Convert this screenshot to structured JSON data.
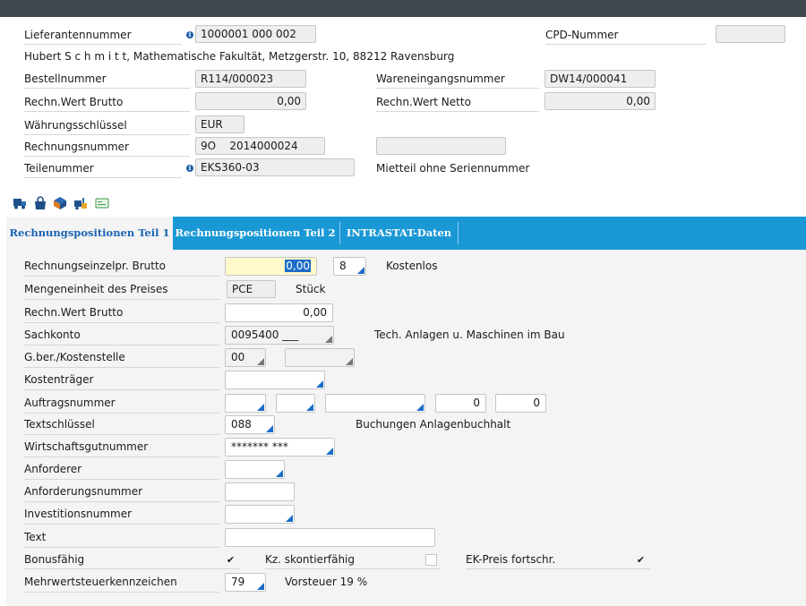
{
  "header": {
    "lieferant_label": "Lieferantennummer",
    "lieferant_value": "1000001 000 002",
    "cpd_label": "CPD-Nummer",
    "cpd_value": "",
    "address": "Hubert S c h m i t t, Mathematische Fakultät, Metzgerstr. 10, 88212 Ravensburg",
    "bestell_label": "Bestellnummer",
    "bestell_value": "R114/000023",
    "wareneingang_label": "Wareneingangsnummer",
    "wareneingang_value": "DW14/000041",
    "brutto_label": "Rechn.Wert Brutto",
    "brutto_value": "0,00",
    "netto_label": "Rechn.Wert Netto",
    "netto_value": "0,00",
    "waehrung_label": "Währungsschlüssel",
    "waehrung_value": "EUR",
    "rechnung_label": "Rechnungsnummer",
    "rechnung_value": "9O    2014000024",
    "rechnung_extra": "",
    "teil_label": "Teilenummer",
    "teil_value": "EKS360-03",
    "teil_desc": "Mietteil ohne Seriennummer"
  },
  "toolbar": {
    "icons": [
      "truck-icon",
      "bag-icon",
      "boxes-icon",
      "forklift-icon",
      "card-icon"
    ]
  },
  "tabs": [
    {
      "label": "Rechnungspositionen Teil 1"
    },
    {
      "label": "Rechnungspositionen Teil 2"
    },
    {
      "label": "INTRASTAT-Daten"
    }
  ],
  "form": {
    "einzelpr_label": "Rechnungseinzelpr. Brutto",
    "einzelpr_value": "0,00",
    "einzelpr_code": "8",
    "einzelpr_desc": "Kostenlos",
    "mengeneinheit_label": "Mengeneinheit des Preises",
    "mengeneinheit_value": "PCE",
    "mengeneinheit_desc": "Stück",
    "brutto_label": "Rechn.Wert Brutto",
    "brutto_value": "0,00",
    "sachkonto_label": "Sachkonto",
    "sachkonto_value": "0095400 ___",
    "sachkonto_desc": "Tech. Anlagen u. Maschinen im Bau",
    "gber_label": "G.ber./Kostenstelle",
    "gber_value": "00",
    "gber_value2": "",
    "kostentraeger_label": "Kostenträger",
    "kostentraeger_value": "",
    "auftrag_label": "Auftragsnummer",
    "auftrag_num1": "0",
    "auftrag_num2": "0",
    "textschluessel_label": "Textschlüssel",
    "textschluessel_value": "088",
    "textschluessel_desc": "Buchungen Anlagenbuchhalt",
    "wirtschaft_label": "Wirtschaftsgutnummer",
    "wirtschaft_value": "******* ***",
    "anforderer_label": "Anforderer",
    "anforderer_value": "",
    "anforderungsnummer_label": "Anforderungsnummer",
    "anforderungsnummer_value": "",
    "investition_label": "Investitionsnummer",
    "investition_value": "",
    "text_label": "Text",
    "text_value": "",
    "bonus_label": "Bonusfähig",
    "bonus_check": "✔",
    "skonto_label": "Kz. skontierfähig",
    "ekpreis_label": "EK-Preis fortschr.",
    "ekpreis_check": "✔",
    "mwst_label": "Mehrwertsteuerkennzeichen",
    "mwst_value": "79",
    "mwst_desc": "Vorsteuer 19 %"
  },
  "colors": {
    "tabbar": "#1a98d5",
    "active_tab_text": "#1a64b4",
    "accent_corner": "#1a6cc8",
    "titlebar": "#3f474e"
  }
}
